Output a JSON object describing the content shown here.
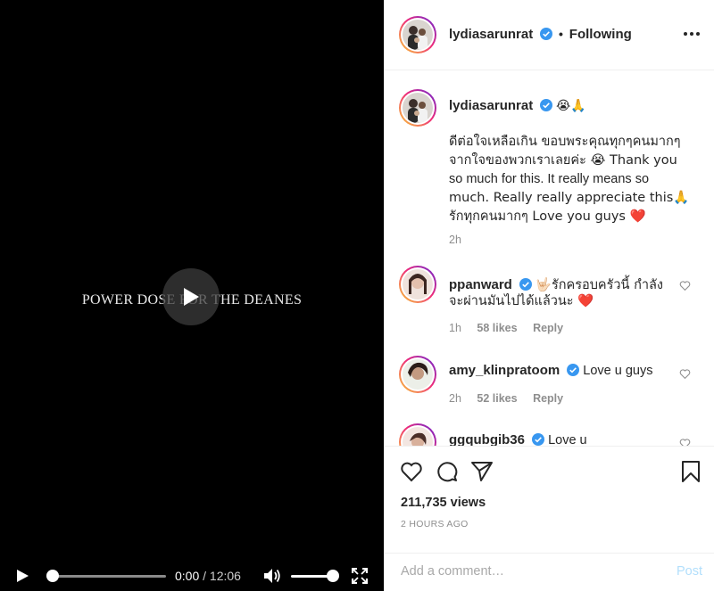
{
  "video": {
    "title": "POWER DOSE FOR THE DEANES",
    "progress": 0.0,
    "volume": 0.85,
    "current_time": "0:00",
    "separator": "/",
    "duration": "12:06"
  },
  "header": {
    "username": "lydiasarunrat",
    "dot": "•",
    "following_label": "Following"
  },
  "caption": {
    "username": "lydiasarunrat",
    "emojis": "😭🙏",
    "text_lines": [
      "ดีต่อใจเหลือเกิน ขอบพระคุณทุกๆคนมากๆ",
      "จากใจของพวกเราเลยค่ะ 😭 Thank you",
      "so much for this. It really means so",
      "much. Really really appreciate this🙏",
      "รักทุกคนมากๆ Love you guys ❤️"
    ],
    "time": "2h"
  },
  "comments": [
    {
      "username": "ppanward",
      "text_line1": "🤟🏻รักครอบครัวนี้ กำลัง",
      "text_line2": "จะผ่านมันไปได้แล้วนะ ❤️",
      "time": "1h",
      "likes": "58 likes",
      "reply": "Reply"
    },
    {
      "username": "amy_klinpratoom",
      "text_line1": "Love u guys",
      "time": "2h",
      "likes": "52 likes",
      "reply": "Reply"
    },
    {
      "username": "ggqubgib36",
      "text_line1": "Love u"
    }
  ],
  "actions": {
    "views": "211,735 views",
    "time_ago": "2 HOURS AGO"
  },
  "add_comment": {
    "placeholder": "Add a comment…",
    "post_label": "Post"
  },
  "colors": {
    "verified": "#3897f0",
    "heart_red": "#ed4956",
    "post_disabled": "#b2dffc"
  }
}
